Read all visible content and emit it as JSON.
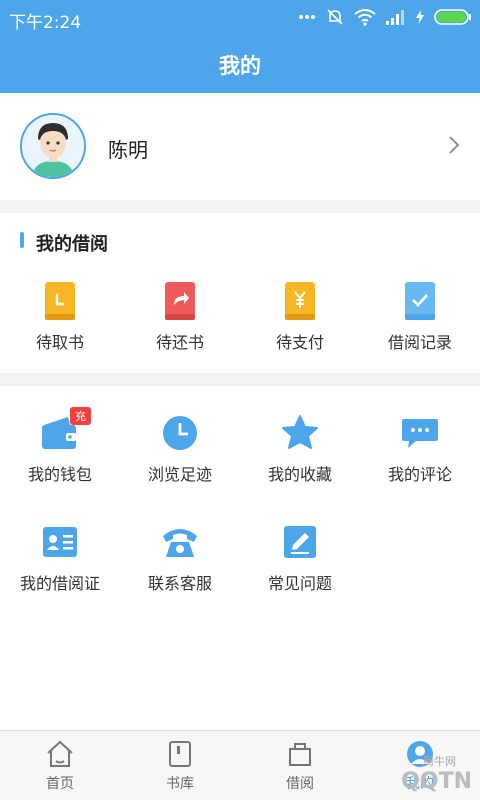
{
  "status_bar": {
    "time": "下午2:24",
    "icons": [
      "more-dots-icon",
      "mute-icon",
      "wifi-icon",
      "signal-icon",
      "charging-icon",
      "battery-icon"
    ]
  },
  "header": {
    "title": "我的"
  },
  "profile": {
    "name": "陈明"
  },
  "borrow": {
    "title": "我的借阅",
    "items": [
      {
        "label": "待取书",
        "icon": "pickup-book-icon"
      },
      {
        "label": "待还书",
        "icon": "return-book-icon"
      },
      {
        "label": "待支付",
        "icon": "payment-icon"
      },
      {
        "label": "借阅记录",
        "icon": "borrow-record-icon"
      }
    ]
  },
  "services": {
    "items": [
      {
        "label": "我的钱包",
        "icon": "wallet-icon",
        "badge": "充"
      },
      {
        "label": "浏览足迹",
        "icon": "history-clock-icon"
      },
      {
        "label": "我的收藏",
        "icon": "star-icon"
      },
      {
        "label": "我的评论",
        "icon": "comment-icon"
      },
      {
        "label": "我的借阅证",
        "icon": "library-card-icon"
      },
      {
        "label": "联系客服",
        "icon": "phone-icon"
      },
      {
        "label": "常见问题",
        "icon": "edit-icon"
      }
    ]
  },
  "bottom_nav": {
    "items": [
      {
        "label": "首页",
        "icon": "home-icon"
      },
      {
        "label": "书库",
        "icon": "library-icon"
      },
      {
        "label": "借阅",
        "icon": "borrow-icon"
      },
      {
        "label": "我的",
        "icon": "profile-icon",
        "active": true
      }
    ]
  },
  "watermark": {
    "text": "QQTN",
    "small": "腾牛网"
  },
  "colors": {
    "primary": "#4da6ea",
    "yellow": "#f7b623",
    "red": "#f15a5a",
    "light_blue": "#6ab8f0",
    "badge": "#f04040"
  }
}
